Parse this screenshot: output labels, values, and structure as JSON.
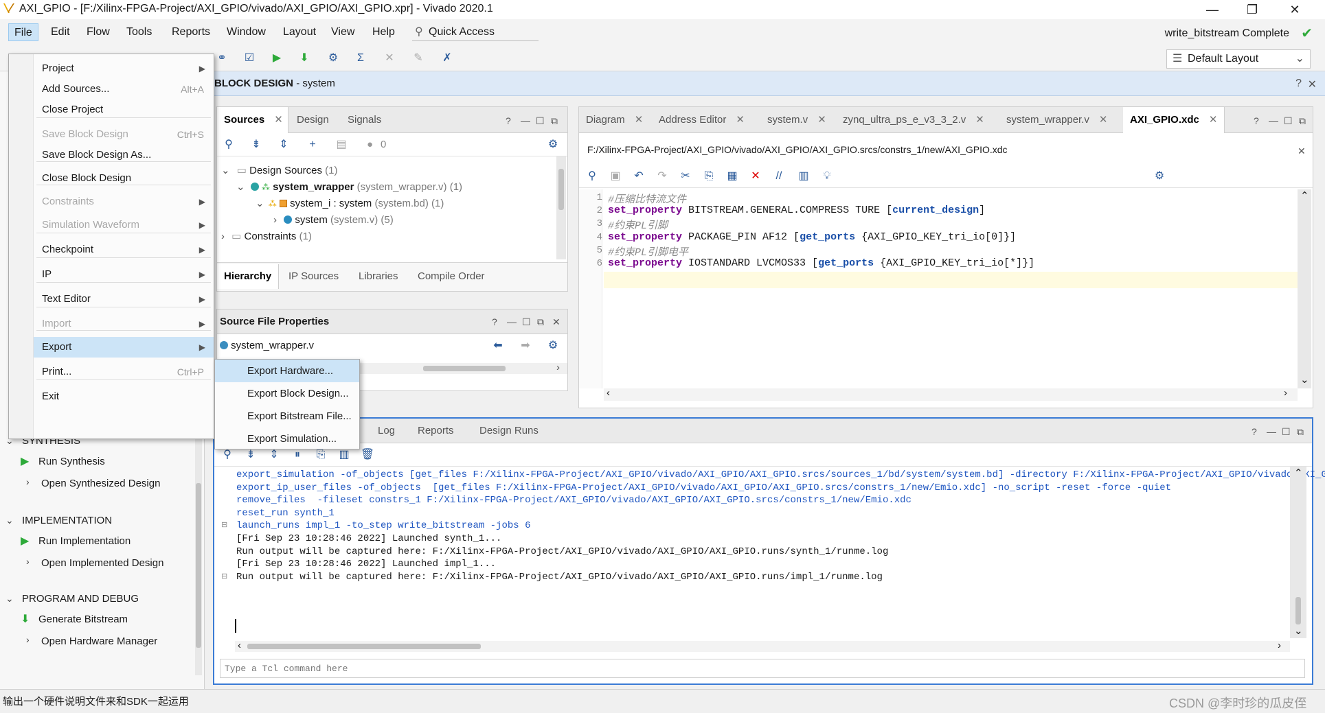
{
  "window": {
    "title": "AXI_GPIO - [F:/Xilinx-FPGA-Project/AXI_GPIO/vivado/AXI_GPIO/AXI_GPIO.xpr] - Vivado 2020.1",
    "minimize": "—",
    "maximize": "❐",
    "close": "✕"
  },
  "menubar": {
    "items": [
      "File",
      "Edit",
      "Flow",
      "Tools",
      "Reports",
      "Window",
      "Layout",
      "View",
      "Help"
    ],
    "quick_access": "Quick Access",
    "status": "write_bitstream Complete"
  },
  "toolbar": {
    "layout": "Default Layout"
  },
  "file_menu": {
    "items": [
      {
        "label": "Project",
        "shortcut": "",
        "submenu": true,
        "disabled": false
      },
      {
        "label": "Add Sources...",
        "shortcut": "Alt+A",
        "submenu": false,
        "disabled": false
      },
      {
        "label": "Close Project",
        "shortcut": "",
        "submenu": false,
        "disabled": false
      },
      {
        "label": "Save Block Design",
        "shortcut": "Ctrl+S",
        "submenu": false,
        "disabled": true
      },
      {
        "label": "Save Block Design As...",
        "shortcut": "",
        "submenu": false,
        "disabled": false
      },
      {
        "label": "Close Block Design",
        "shortcut": "",
        "submenu": false,
        "disabled": false
      },
      {
        "label": "Constraints",
        "shortcut": "",
        "submenu": true,
        "disabled": true
      },
      {
        "label": "Simulation Waveform",
        "shortcut": "",
        "submenu": true,
        "disabled": true
      },
      {
        "label": "Checkpoint",
        "shortcut": "",
        "submenu": true,
        "disabled": false
      },
      {
        "label": "IP",
        "shortcut": "",
        "submenu": true,
        "disabled": false
      },
      {
        "label": "Text Editor",
        "shortcut": "",
        "submenu": true,
        "disabled": false
      },
      {
        "label": "Import",
        "shortcut": "",
        "submenu": true,
        "disabled": true
      },
      {
        "label": "Export",
        "shortcut": "",
        "submenu": true,
        "disabled": false
      },
      {
        "label": "Print...",
        "shortcut": "Ctrl+P",
        "submenu": false,
        "disabled": false
      },
      {
        "label": "Exit",
        "shortcut": "",
        "submenu": false,
        "disabled": false
      }
    ]
  },
  "export_menu": {
    "items": [
      "Export Hardware...",
      "Export Block Design...",
      "Export Bitstream File...",
      "Export Simulation..."
    ]
  },
  "flow_navigator": {
    "synthesis": {
      "title": "SYNTHESIS",
      "run": "Run Synthesis",
      "open": "Open Synthesized Design"
    },
    "implementation": {
      "title": "IMPLEMENTATION",
      "run": "Run Implementation",
      "open": "Open Implemented Design"
    },
    "program": {
      "title": "PROGRAM AND DEBUG",
      "generate": "Generate Bitstream",
      "open": "Open Hardware Manager"
    }
  },
  "block_design": {
    "title": "BLOCK DESIGN",
    "name": "- system"
  },
  "sources": {
    "tabs": [
      "Sources",
      "Design",
      "Signals"
    ],
    "count_badge": "0",
    "tree": {
      "design_sources": "Design Sources",
      "design_sources_count": "(1)",
      "wrapper": "system_wrapper",
      "wrapper_detail": "(system_wrapper.v) (1)",
      "system_i": "system_i",
      "system_i_detail": ": system",
      "system_i_file": "(system.bd) (1)",
      "system": "system",
      "system_detail": "(system.v) (5)",
      "constraints": "Constraints",
      "constraints_count": "(1)"
    },
    "bottom_tabs": [
      "Hierarchy",
      "IP Sources",
      "Libraries",
      "Compile Order"
    ]
  },
  "source_props": {
    "title": "Source File Properties",
    "file": "system_wrapper.v"
  },
  "editor": {
    "tabs": [
      "Diagram",
      "Address Editor",
      "system.v",
      "zynq_ultra_ps_e_v3_3_2.v",
      "system_wrapper.v",
      "AXI_GPIO.xdc"
    ],
    "path": "F:/Xilinx-FPGA-Project/AXI_GPIO/vivado/AXI_GPIO/AXI_GPIO.srcs/constrs_1/new/AXI_GPIO.xdc",
    "lines": [
      {
        "n": "1",
        "comment": "#压缩比特流文件"
      },
      {
        "n": "2",
        "kw": "set_property",
        "text": " BITSTREAM.GENERAL.COMPRESS TURE [",
        "br": "current_design",
        "tail": "]"
      },
      {
        "n": "3",
        "comment": "#约束PL引脚"
      },
      {
        "n": "4",
        "kw": "set_property",
        "text": " PACKAGE_PIN AF12 [",
        "br": "get_ports",
        "tail": " {AXI_GPIO_KEY_tri_io[0]}]"
      },
      {
        "n": "5",
        "comment": "#约束PL引脚电平"
      },
      {
        "n": "6",
        "kw": "set_property",
        "text": " IOSTANDARD LVCMOS33 [",
        "br": "get_ports",
        "tail": " {AXI_GPIO_KEY_tri_io[*]}]"
      }
    ]
  },
  "console": {
    "tabs": [
      "Log",
      "Reports",
      "Design Runs"
    ],
    "lines": [
      {
        "style": "blue",
        "text": "export_simulation -of_objects [get_files F:/Xilinx-FPGA-Project/AXI_GPIO/vivado/AXI_GPIO/AXI_GPIO.srcs/sources_1/bd/system/system.bd] -directory F:/Xilinx-FPGA-Project/AXI_GPIO/vivado/AXI_GPI("
      },
      {
        "style": "blue",
        "text": "export_ip_user_files -of_objects  [get_files F:/Xilinx-FPGA-Project/AXI_GPIO/vivado/AXI_GPIO/AXI_GPIO.srcs/constrs_1/new/Emio.xdc] -no_script -reset -force -quiet"
      },
      {
        "style": "blue",
        "text": "remove_files  -fileset constrs_1 F:/Xilinx-FPGA-Project/AXI_GPIO/vivado/AXI_GPIO/AXI_GPIO.srcs/constrs_1/new/Emio.xdc"
      },
      {
        "style": "blue",
        "text": "reset_run synth_1"
      },
      {
        "style": "blue",
        "text": "launch_runs impl_1 -to_step write_bitstream -jobs 6"
      },
      {
        "style": "plain",
        "text": "[Fri Sep 23 10:28:46 2022] Launched synth_1..."
      },
      {
        "style": "plain",
        "text": "Run output will be captured here: F:/Xilinx-FPGA-Project/AXI_GPIO/vivado/AXI_GPIO/AXI_GPIO.runs/synth_1/runme.log"
      },
      {
        "style": "plain",
        "text": "[Fri Sep 23 10:28:46 2022] Launched impl_1..."
      },
      {
        "style": "plain",
        "text": "Run output will be captured here: F:/Xilinx-FPGA-Project/AXI_GPIO/vivado/AXI_GPIO/AXI_GPIO.runs/impl_1/runme.log"
      }
    ],
    "input_placeholder": "Type a Tcl command here"
  },
  "statusbar": {
    "text": "输出一个硬件说明文件来和SDK一起运用",
    "watermark": "CSDN @李时珍的瓜皮侄"
  }
}
